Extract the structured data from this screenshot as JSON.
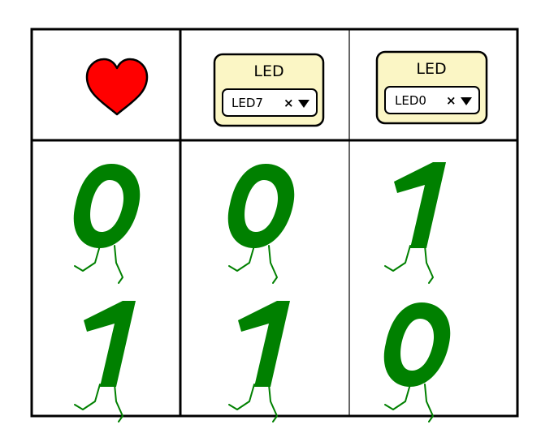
{
  "header": {
    "icon": "heart-icon",
    "heart_color": "#ff0000",
    "blocks": [
      {
        "title": "LED",
        "selected": "LED7",
        "clear": "×",
        "fill": "#fbf6c5"
      },
      {
        "title": "LED",
        "selected": "LED0",
        "clear": "×",
        "fill": "#fbf6c5"
      }
    ]
  },
  "digit_color": "#008000",
  "rows": [
    [
      "0",
      "0",
      "1"
    ],
    [
      "1",
      "1",
      "0"
    ]
  ]
}
